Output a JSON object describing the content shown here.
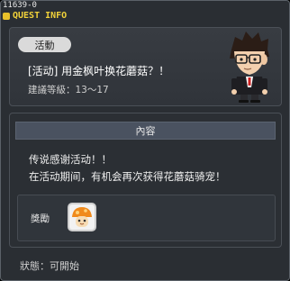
{
  "window": {
    "quest_id": "11639-0",
    "title": "QUEST INFO"
  },
  "quest": {
    "tag": "活動",
    "name": "[活动] 用金枫叶换花蘑菇？！",
    "level": "建議等級：13～17"
  },
  "content": {
    "header": "內容",
    "lines": [
      "传说感谢活动！！",
      "在活动期间，有机会再次获得花蘑菇骑宠！"
    ]
  },
  "reward": {
    "label": "獎勵",
    "item_icon": "flower-mushroom-icon"
  },
  "status": "狀態：可開始",
  "colors": {
    "title": "#f1d23a",
    "window_bg": "#2a2e33",
    "header_bg": "#4a5260"
  }
}
